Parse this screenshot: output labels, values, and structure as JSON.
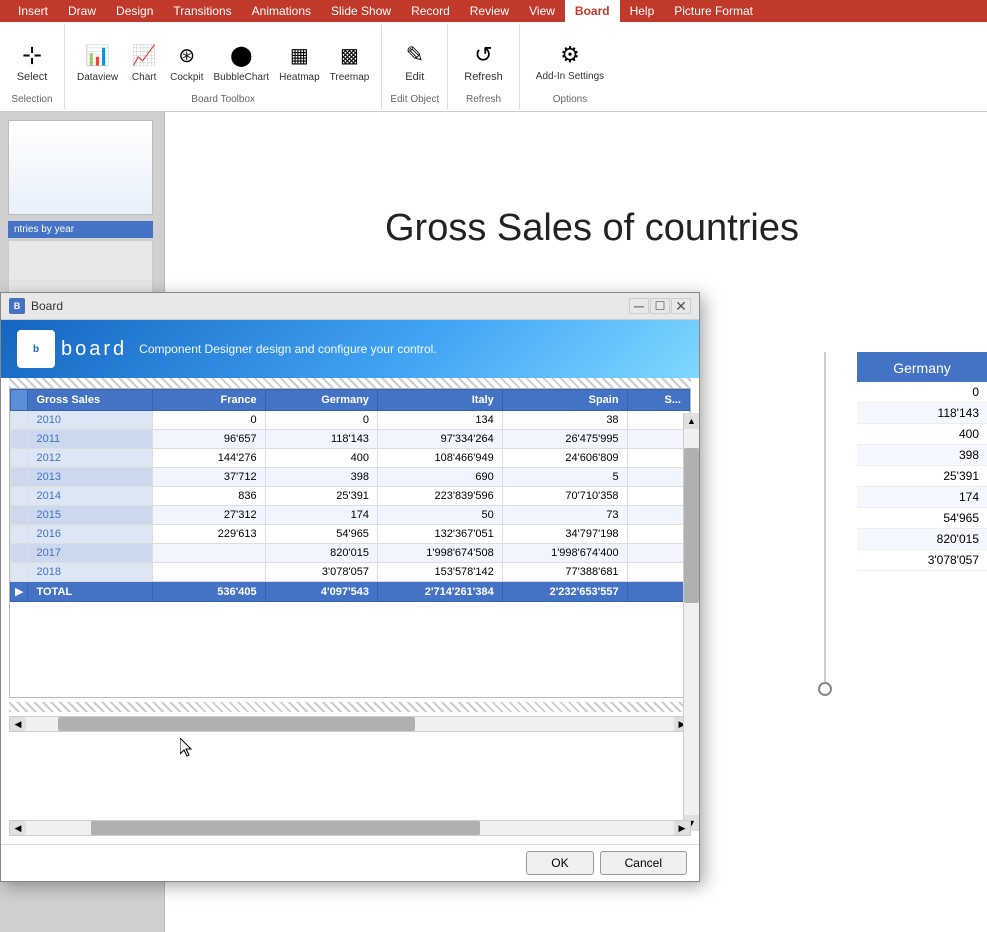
{
  "ribbon": {
    "tabs": [
      "Insert",
      "Draw",
      "Design",
      "Transitions",
      "Animations",
      "Slide Show",
      "Record",
      "Review",
      "View",
      "Board",
      "Help",
      "Picture Format"
    ],
    "active_tab": "Board",
    "groups": {
      "selection": {
        "label": "Selection",
        "buttons": [
          {
            "label": "Select",
            "icon": "⊹"
          }
        ]
      },
      "board_toolbox": {
        "label": "Board Toolbox",
        "buttons": [
          {
            "label": "Dataview",
            "icon": "📊"
          },
          {
            "label": "Chart",
            "icon": "📈"
          },
          {
            "label": "Cockpit",
            "icon": "⊛"
          },
          {
            "label": "BubbleChart",
            "icon": "⬤"
          },
          {
            "label": "Heatmap",
            "icon": "▦"
          },
          {
            "label": "Treemap",
            "icon": "▩"
          }
        ]
      },
      "edit_object": {
        "label": "Edit Object",
        "buttons": [
          {
            "label": "Edit",
            "icon": "✎"
          }
        ]
      },
      "refresh_group": {
        "label": "Refresh",
        "buttons": [
          {
            "label": "Refresh",
            "icon": "↺"
          }
        ]
      },
      "options": {
        "label": "Options",
        "buttons": [
          {
            "label": "Add-In\nSettings",
            "icon": "⚙"
          }
        ]
      }
    }
  },
  "slide": {
    "title": "Gross Sales of countries"
  },
  "dialog": {
    "title": "Board",
    "subtitle": "Component Designer design and configure your control.",
    "logo_text": "board",
    "table": {
      "columns": [
        "Gross Sales",
        "France",
        "Germany",
        "Italy",
        "Spain",
        "S..."
      ],
      "rows": [
        {
          "year": "2010",
          "france": "0",
          "germany": "0",
          "italy": "134",
          "spain": "38"
        },
        {
          "year": "2011",
          "france": "96'657",
          "germany": "118'143",
          "italy": "97'334'264",
          "spain": "26'475'995"
        },
        {
          "year": "2012",
          "france": "144'276",
          "germany": "400",
          "italy": "108'466'949",
          "spain": "24'606'809"
        },
        {
          "year": "2013",
          "france": "37'712",
          "germany": "398",
          "italy": "690",
          "spain": "5"
        },
        {
          "year": "2014",
          "france": "836",
          "germany": "25'391",
          "italy": "223'839'596",
          "spain": "70'710'358"
        },
        {
          "year": "2015",
          "france": "27'312",
          "germany": "174",
          "italy": "50",
          "spain": "73"
        },
        {
          "year": "2016",
          "france": "229'613",
          "germany": "54'965",
          "italy": "132'367'051",
          "spain": "34'797'198"
        },
        {
          "year": "2017",
          "france": "",
          "germany": "820'015",
          "italy": "1'998'674'508",
          "spain": "1'998'674'400"
        },
        {
          "year": "2018",
          "france": "",
          "germany": "3'078'057",
          "italy": "153'578'142",
          "spain": "77'388'681"
        }
      ],
      "total": {
        "label": "TOTAL",
        "france": "536'405",
        "germany": "4'097'543",
        "italy": "2'714'261'384",
        "spain": "2'232'653'557"
      }
    },
    "buttons": {
      "ok": "OK",
      "cancel": "Cancel"
    }
  },
  "right_panel": {
    "header": "Germany",
    "values": [
      "0",
      "118'143",
      "400",
      "398",
      "25'391",
      "174",
      "54'965",
      "820'015",
      "3'078'057"
    ]
  }
}
